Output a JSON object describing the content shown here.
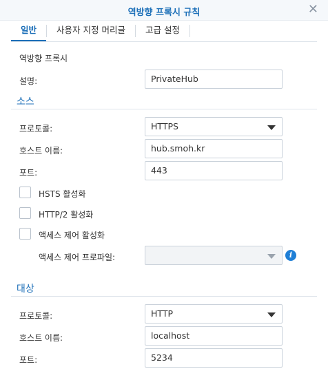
{
  "dialog": {
    "title": "역방향 프록시 규칙",
    "close_symbol": "✕"
  },
  "tabs": [
    {
      "label": "일반",
      "active": true
    },
    {
      "label": "사용자 지정 머리글",
      "active": false
    },
    {
      "label": "고급 설정",
      "active": false
    }
  ],
  "general": {
    "section_label": "역방향 프록시",
    "description": {
      "label": "설명:",
      "value": "PrivateHub"
    }
  },
  "source": {
    "title": "소스",
    "protocol": {
      "label": "프로토콜:",
      "value": "HTTPS"
    },
    "hostname": {
      "label": "호스트 이름:",
      "value": "hub.smoh.kr"
    },
    "port": {
      "label": "포트:",
      "value": "443"
    },
    "hsts": {
      "label": "HSTS 활성화",
      "checked": false
    },
    "http2": {
      "label": "HTTP/2 활성화",
      "checked": false
    },
    "access_control": {
      "label": "액세스 제어 활성화",
      "checked": false
    },
    "access_profile": {
      "label": "액세스 제어 프로파일:",
      "value": ""
    }
  },
  "destination": {
    "title": "대상",
    "protocol": {
      "label": "프로토콜:",
      "value": "HTTP"
    },
    "hostname": {
      "label": "호스트 이름:",
      "value": "localhost"
    },
    "port": {
      "label": "포트:",
      "value": "5234"
    }
  },
  "colors": {
    "accent": "#1c6fb8",
    "info": "#1f7fd6",
    "border": "#c9d1da"
  },
  "icons": {
    "close": "close-icon",
    "info": "info-icon",
    "dropdown": "chevron-down-icon"
  }
}
